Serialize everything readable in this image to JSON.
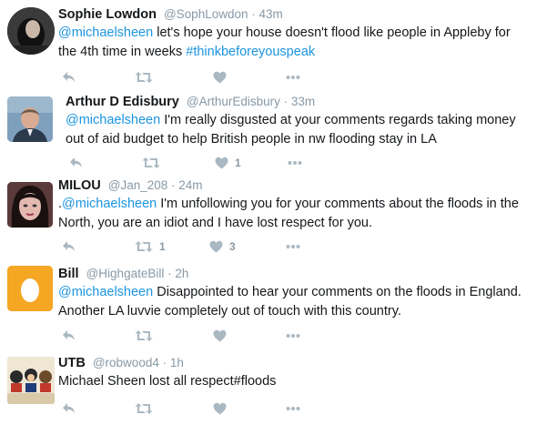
{
  "tweets": [
    {
      "name": "Sophie Lowdon",
      "handle": "@SophLowdon",
      "time": "43m",
      "lines": [
        {
          "mention": "@michaelsheen",
          "text": " let's hope your house doesn't flood like people in Appleby for"
        },
        {
          "text": "the 4th time in weeks ",
          "hashtag": "#thinkbeforeyouspeak"
        }
      ],
      "retweets": "",
      "likes": ""
    },
    {
      "name": "Arthur D Edisbury",
      "handle": "@ArthurEdisbury",
      "time": "33m",
      "lines": [
        {
          "mention": "@michaelsheen",
          "text": "  I'm really disgusted at your comments regards taking money"
        },
        {
          "text": "out of aid budget to help British people in nw flooding stay in LA"
        }
      ],
      "retweets": "",
      "likes": "1"
    },
    {
      "name": "MILOU",
      "handle": "@Jan_208",
      "time": "24m",
      "lines": [
        {
          "prefix": ".",
          "mention": "@michaelsheen",
          "text": " I'm unfollowing you for your comments about the floods in the"
        },
        {
          "text": "North, you are an idiot and I have lost respect for you."
        }
      ],
      "retweets": "1",
      "likes": "3"
    },
    {
      "name": "Bill",
      "handle": "@HighgateBill",
      "time": "2h",
      "lines": [
        {
          "mention": "@michaelsheen",
          "text": " Disappointed to hear your comments on the floods in England."
        },
        {
          "text": "Another LA luvvie completely out of touch with this country."
        }
      ],
      "retweets": "",
      "likes": ""
    },
    {
      "name": "UTB",
      "handle": "@robwood4",
      "time": "1h",
      "lines": [
        {
          "text": "Michael Sheen lost all respect#floods"
        }
      ],
      "retweets": "",
      "likes": ""
    }
  ],
  "separator": " · ",
  "colors": {
    "name": "#14171a",
    "meta": "#8899a6",
    "link": "#1b95e0",
    "icon": "#aab8c2",
    "egg_bg": "#f5a623"
  },
  "icons": [
    "reply-icon",
    "retweet-icon",
    "like-icon",
    "more-icon"
  ]
}
